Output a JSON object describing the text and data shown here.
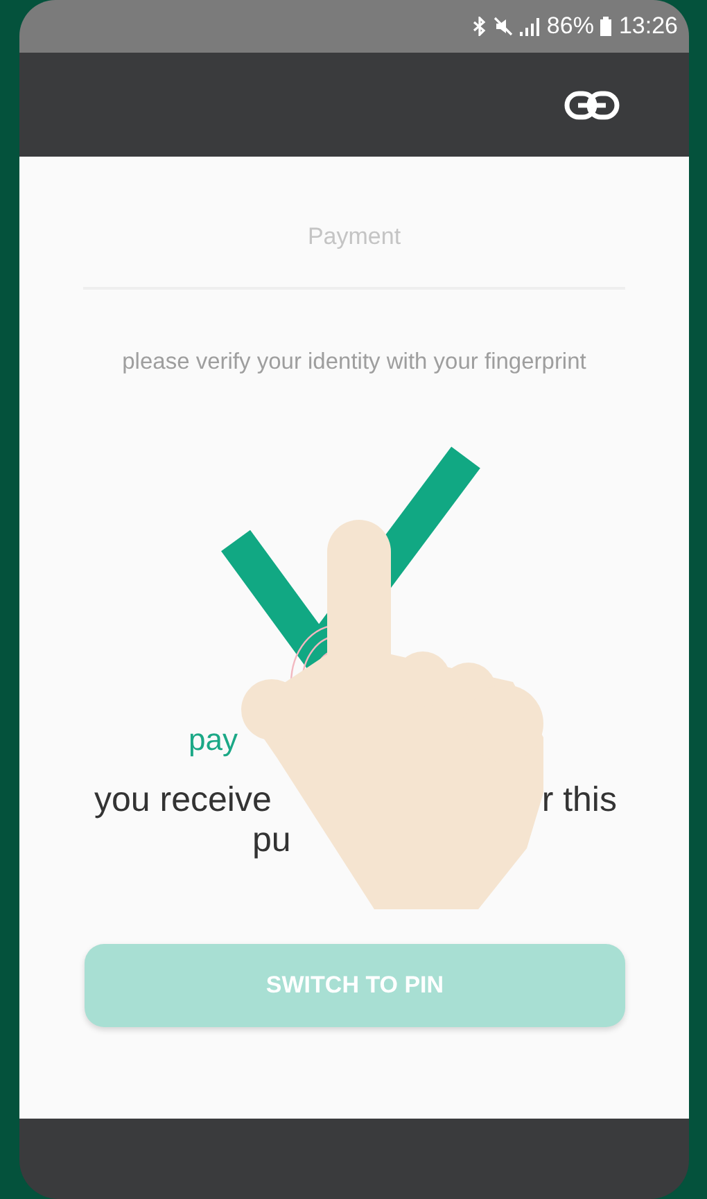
{
  "status_bar": {
    "battery": "86%",
    "time": "13:26"
  },
  "title": "Payment",
  "subtitle": "please verify your identity with your fingerprint",
  "result": {
    "title": "pay",
    "line_1_start": "you receive",
    "line_1_end": "r this",
    "line_2_start": "pu"
  },
  "button": "SWITCH TO PIN"
}
